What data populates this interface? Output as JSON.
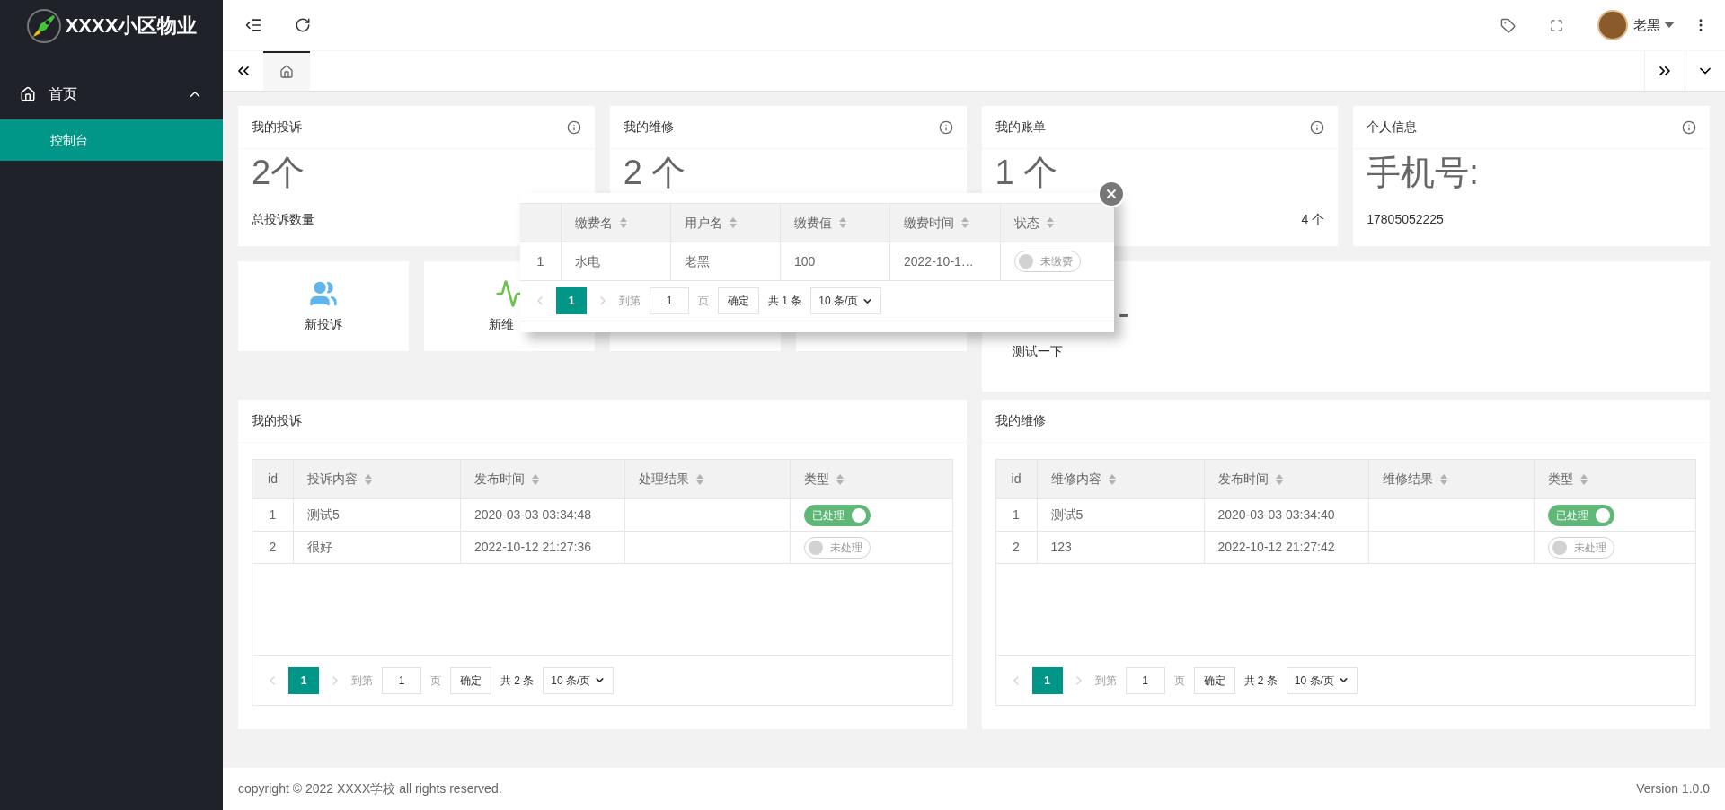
{
  "brand": {
    "title": "XXXX小区物业"
  },
  "sidebar": {
    "items": [
      {
        "label": "首页",
        "expanded": true,
        "children": [
          {
            "label": "控制台",
            "selected": true
          }
        ]
      }
    ]
  },
  "header": {
    "user": "老黑"
  },
  "tabs": [
    {
      "kind": "home",
      "selected": true
    }
  ],
  "stat_cards": [
    {
      "title": "我的投诉",
      "value": "2个",
      "caption": "总投诉数量"
    },
    {
      "title": "我的维修",
      "value": "2 个"
    },
    {
      "title": "我的账单",
      "value": "1 个",
      "extra": "4 个"
    },
    {
      "title": "个人信息",
      "value": "手机号:",
      "caption": "17805052225"
    }
  ],
  "shortcuts": [
    {
      "kind": "complaint",
      "label": "新投诉"
    },
    {
      "kind": "repair",
      "label": "新维"
    }
  ],
  "notice": {
    "heading": "-",
    "body": "测试一下"
  },
  "tables": [
    {
      "title": "我的投诉",
      "columns": [
        {
          "label": "id",
          "sortable": false
        },
        {
          "label": "投诉内容",
          "sortable": true
        },
        {
          "label": "发布时间",
          "sortable": true
        },
        {
          "label": "处理结果",
          "sortable": true
        },
        {
          "label": "类型",
          "sortable": true
        }
      ],
      "rows": [
        {
          "id": "1",
          "content": "测试5",
          "time": "2020-03-03 03:34:48",
          "status": {
            "label": "已处理",
            "on": true
          }
        },
        {
          "id": "2",
          "content": "很好",
          "time": "2022-10-12 21:27:36",
          "status": {
            "label": "未处理",
            "on": false
          }
        }
      ],
      "pager": {
        "page": "1",
        "goto_label": "到第",
        "goto_value": "1",
        "page_unit": "页",
        "confirm": "确定",
        "total": "共 2 条",
        "page_size": "10 条/页"
      }
    },
    {
      "title": "我的维修",
      "columns": [
        {
          "label": "id",
          "sortable": false
        },
        {
          "label": "维修内容",
          "sortable": true
        },
        {
          "label": "发布时间",
          "sortable": true
        },
        {
          "label": "维修结果",
          "sortable": true
        },
        {
          "label": "类型",
          "sortable": true
        }
      ],
      "rows": [
        {
          "id": "1",
          "content": "测试5",
          "time": "2020-03-03 03:34:40",
          "status": {
            "label": "已处理",
            "on": true
          }
        },
        {
          "id": "2",
          "content": "123",
          "time": "2022-10-12 21:27:42",
          "status": {
            "label": "未处理",
            "on": false
          }
        }
      ],
      "pager": {
        "page": "1",
        "goto_label": "到第",
        "goto_value": "1",
        "page_unit": "页",
        "confirm": "确定",
        "total": "共 2 条",
        "page_size": "10 条/页"
      }
    }
  ],
  "popup": {
    "columns": [
      {
        "label": "缴费名",
        "sortable": true
      },
      {
        "label": "用户名",
        "sortable": true
      },
      {
        "label": "缴费值",
        "sortable": true
      },
      {
        "label": "缴费时间",
        "sortable": true
      },
      {
        "label": "状态",
        "sortable": true
      }
    ],
    "rows": [
      {
        "index": "1",
        "cells": [
          "水电",
          "老黑",
          "100",
          "2022-10-1…"
        ],
        "status": {
          "label": "未缴费",
          "on": false
        }
      }
    ],
    "pager": {
      "page": "1",
      "goto_label": "到第",
      "goto_value": "1",
      "page_unit": "页",
      "confirm": "确定",
      "total": "共 1 条",
      "page_size": "10 条/页"
    }
  },
  "footer": {
    "copyright": "copyright © 2022 XXXX学校 all rights reserved.",
    "version": "Version 1.0.0"
  }
}
